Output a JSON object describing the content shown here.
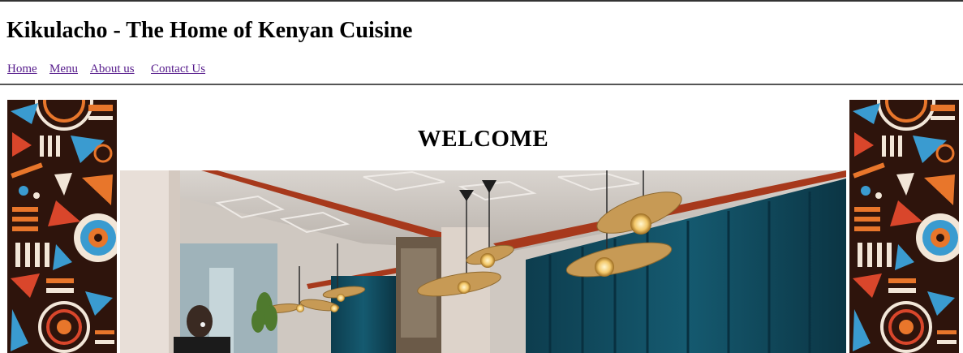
{
  "site": {
    "title": "Kikulacho - The Home of Kenyan Cuisine"
  },
  "nav": {
    "items": [
      {
        "label": "Home"
      },
      {
        "label": "Menu"
      },
      {
        "label": "About us"
      },
      {
        "label": "Contact Us"
      }
    ]
  },
  "main": {
    "heading": "WELCOME"
  },
  "colors": {
    "link": "#551a8b",
    "art_background": "#2e140c",
    "art_accents": [
      "#e8762b",
      "#3a9bd0",
      "#ffffff",
      "#d9462b"
    ],
    "curtain": "#0f4a5e",
    "beam": "#a7391c"
  }
}
